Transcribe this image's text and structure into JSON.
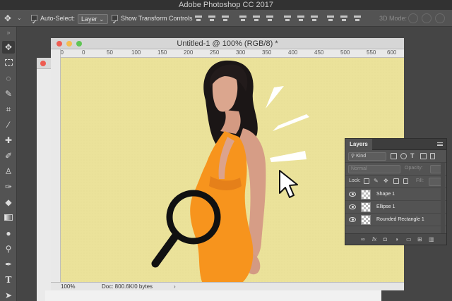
{
  "app": {
    "title": "Adobe Photoshop CC 2017"
  },
  "options": {
    "auto_select_label": "Auto-Select:",
    "auto_select_value": "Layer",
    "show_transform_label": "Show Transform Controls",
    "mode_3d_label": "3D Mode:"
  },
  "document": {
    "title": "Untitled-1 @ 100% (RGB/8) *",
    "ruler_labels": [
      "50",
      "0",
      "50",
      "100",
      "150",
      "200",
      "250",
      "300",
      "350",
      "400",
      "450",
      "500",
      "550",
      "600"
    ],
    "zoom": "100%",
    "doc_info": "Doc: 800.6K/0 bytes",
    "canvas_color": "#ebe29a"
  },
  "layers_panel": {
    "tab": "Layers",
    "filter_label": "Kind",
    "blend_mode": "Normal",
    "opacity_label": "Opacity:",
    "lock_label": "Lock:",
    "fill_label": "Fill:",
    "layers": [
      {
        "name": "Shape 1"
      },
      {
        "name": "Ellipse 1"
      },
      {
        "name": "Rounded Rectangle 1"
      }
    ]
  },
  "colors": {
    "app_bg": "#454545",
    "panel": "#535353",
    "accent_dress": "#f7941d"
  }
}
